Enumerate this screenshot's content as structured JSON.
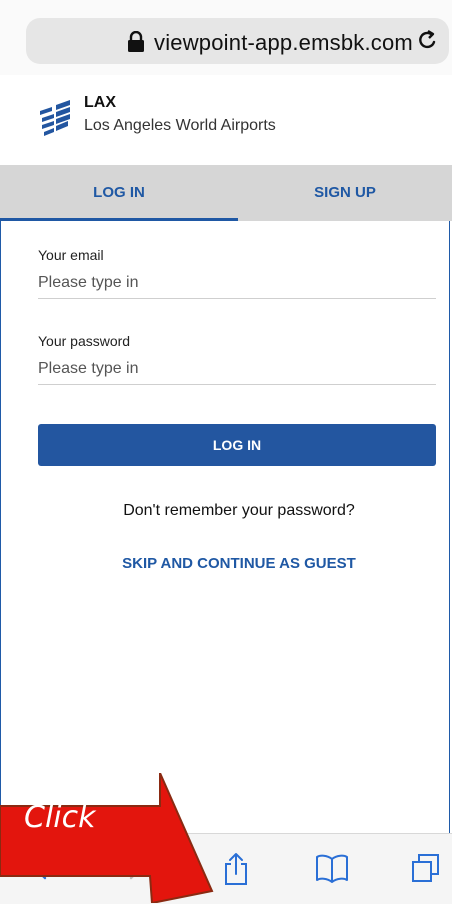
{
  "browser": {
    "url": "viewpoint-app.emsbk.com",
    "lock_icon": "lock-icon",
    "reload_icon": "reload-icon"
  },
  "app": {
    "title": "LAX",
    "subtitle": "Los Angeles World Airports",
    "brand_color": "#2356a0"
  },
  "tabs": [
    {
      "label": "LOG IN",
      "active": true
    },
    {
      "label": "SIGN UP",
      "active": false
    }
  ],
  "form": {
    "email_label": "Your email",
    "email_placeholder": "Please type in",
    "password_label": "Your password",
    "password_placeholder": "Please type in",
    "submit_label": "LOG IN"
  },
  "links": {
    "forgot": "Don't remember your password?",
    "guest": "SKIP AND CONTINUE AS GUEST"
  },
  "toolbar": {
    "icons": [
      "back-icon",
      "forward-icon",
      "share-icon",
      "bookmarks-icon",
      "tabs-icon"
    ]
  },
  "annotation": {
    "label": "Click",
    "arrow_color": "#e3150d"
  }
}
